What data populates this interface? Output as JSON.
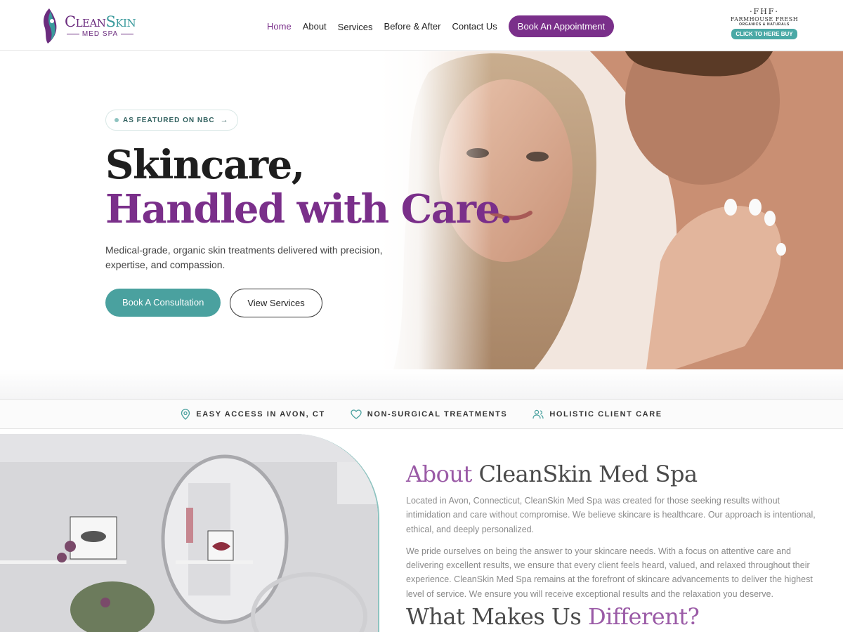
{
  "header": {
    "logo": {
      "name_a": "Clean",
      "name_b": "Skin",
      "sub": "MED SPA"
    },
    "nav": [
      {
        "label": "Home",
        "active": true
      },
      {
        "label": "About"
      },
      {
        "label": "Services"
      },
      {
        "label": "Before & After"
      },
      {
        "label": "Contact Us"
      }
    ],
    "cta": "Book An Appointment",
    "partner": {
      "mono": "·FHF·",
      "name": "FARMHOUSE FRESH",
      "tag": "ORGANICS & NATURALS",
      "button": "CLICK TO HERE BUY"
    }
  },
  "hero": {
    "badge": "AS FEATURED ON NBC",
    "title_line1": "Skincare,",
    "title_line2": "Handled with Care.",
    "subtitle": "Medical-grade, organic skin treatments delivered with precision, expertise, and compassion.",
    "primary_button": "Book A Consultation",
    "secondary_button": "View Services"
  },
  "features": [
    {
      "icon": "location-pin-icon",
      "label": "EASY ACCESS IN AVON, CT"
    },
    {
      "icon": "heart-icon",
      "label": "NON-SURGICAL TREATMENTS"
    },
    {
      "icon": "users-icon",
      "label": "HOLISTIC CLIENT CARE"
    }
  ],
  "about": {
    "title_accent": "About",
    "title_rest": "CleanSkin Med Spa",
    "p1": "Located in Avon, Connecticut, CleanSkin Med Spa was created for those seeking results without intimidation and care without compromise. We believe skincare is healthcare. Our approach is intentional, ethical, and deeply personalized.",
    "p2": "We pride ourselves on being the answer to your skincare needs. With a focus on attentive care and delivering excellent results, we ensure that every client feels heard, valued, and relaxed throughout their experience. CleanSkin Med Spa remains at the forefront of skincare advancements to deliver the highest level of service. We ensure you will receive exceptional results and the relaxation you deserve.",
    "subtitle_rest": "What Makes Us",
    "subtitle_accent": "Different?"
  },
  "colors": {
    "brand_purple": "#7a2f8a",
    "brand_teal": "#4aa19f"
  }
}
